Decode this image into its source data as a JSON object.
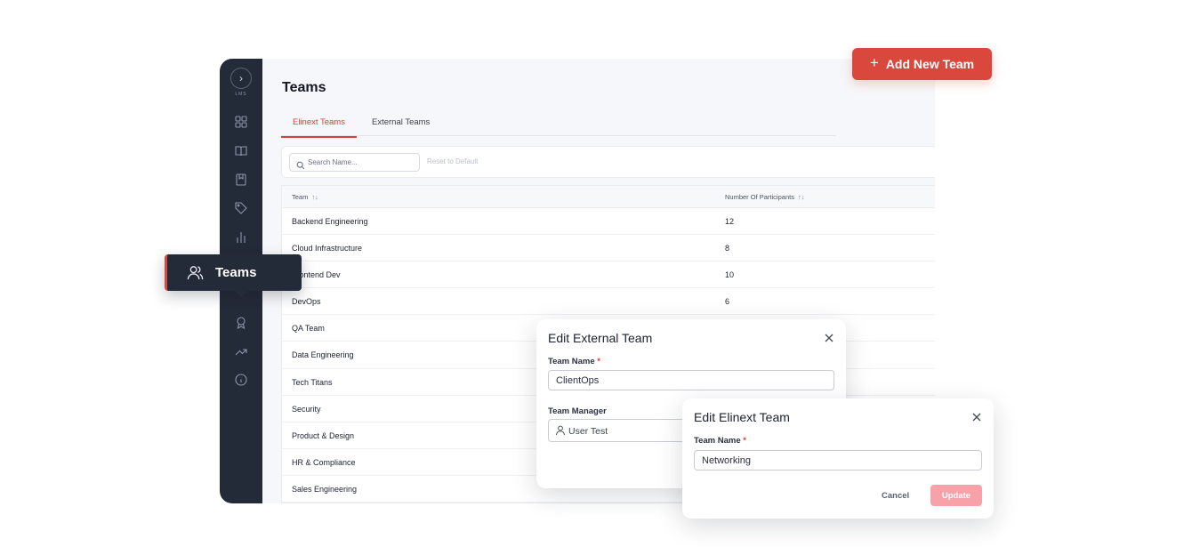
{
  "sidebar": {
    "brand": "LMS",
    "icons": [
      "dashboard-icon",
      "book-icon",
      "bookmark-icon",
      "tag-icon",
      "bar-chart-icon",
      "award-icon",
      "trending-icon",
      "info-icon"
    ]
  },
  "page": {
    "title": "Teams"
  },
  "tabs": [
    {
      "label": "Elinext Teams",
      "active": true
    },
    {
      "label": "External Teams",
      "active": false
    }
  ],
  "toolbar": {
    "search_placeholder": "Search Name...",
    "reset_label": "Reset to Default"
  },
  "table": {
    "columns": [
      "Team",
      "Number Of Participants"
    ],
    "sort_glyph": "↑↓",
    "rows": [
      {
        "team": "Backend Engineering",
        "participants": "12"
      },
      {
        "team": "Cloud Infrastructure",
        "participants": "8"
      },
      {
        "team": "Frontend Dev",
        "participants": "10"
      },
      {
        "team": "DevOps",
        "participants": "6"
      },
      {
        "team": "QA Team",
        "participants": ""
      },
      {
        "team": "Data Engineering",
        "participants": ""
      },
      {
        "team": "Tech Titans",
        "participants": ""
      },
      {
        "team": "Security",
        "participants": ""
      },
      {
        "team": "Product & Design",
        "participants": ""
      },
      {
        "team": "HR & Compliance",
        "participants": ""
      },
      {
        "team": "Sales Engineering",
        "participants": ""
      }
    ]
  },
  "add_button": {
    "label": "Add New Team",
    "icon": "plus-icon",
    "color": "#d9473d"
  },
  "teams_tooltip": {
    "label": "Teams",
    "icon": "users-icon"
  },
  "edit_external": {
    "title": "Edit External Team",
    "name_label": "Team Name",
    "name_value": "ClientOps",
    "manager_label": "Team Manager",
    "manager_value": "User Test"
  },
  "edit_elinext": {
    "title": "Edit Elinext Team",
    "name_label": "Team Name",
    "name_value": "Networking",
    "cancel_label": "Cancel",
    "update_label": "Update"
  },
  "required_mark": "*",
  "colors": {
    "accent": "#d9473d",
    "sidebar": "#232a38",
    "update_disabled": "#f7a1a8"
  }
}
